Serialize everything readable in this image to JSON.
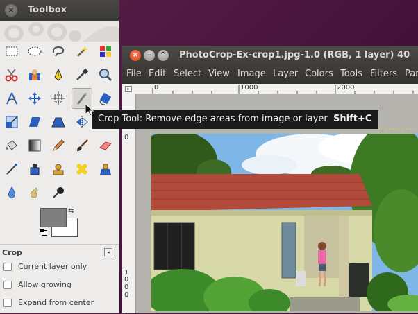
{
  "toolbox": {
    "title": "Toolbox",
    "close_glyph": "×",
    "tool_options": {
      "title": "Crop",
      "menu_glyph": "◂",
      "options": [
        {
          "label": "Current layer only",
          "checked": false
        },
        {
          "label": "Allow growing",
          "checked": false
        },
        {
          "label": "Expand from center",
          "checked": false
        }
      ]
    },
    "colors": {
      "foreground": "#7f7f7f",
      "background": "#ffffff"
    },
    "tools": [
      "rect-select-icon",
      "ellipse-select-icon",
      "free-select-icon",
      "fuzzy-select-icon",
      "color-select-icon",
      "scissors-icon",
      "foreground-select-icon",
      "paths-icon",
      "color-picker-icon",
      "zoom-icon",
      "measure-icon",
      "move-icon",
      "align-icon",
      "crop-icon",
      "rotate-icon",
      "scale-icon",
      "shear-icon",
      "perspective-icon",
      "flip-icon",
      "cage-icon",
      "bucket-fill-icon",
      "blend-icon",
      "pencil-icon",
      "paintbrush-icon",
      "eraser-icon",
      "airbrush-icon",
      "ink-icon",
      "clone-icon",
      "heal-icon",
      "perspective-clone-icon",
      "blur-icon",
      "smudge-icon",
      "dodge-burn-icon"
    ],
    "active_tool": "crop-icon"
  },
  "image_window": {
    "title": "PhotoCrop-Ex-crop1.jpg-1.0 (RGB, 1 layer) 40",
    "menu": [
      "File",
      "Edit",
      "Select",
      "View",
      "Image",
      "Layer",
      "Colors",
      "Tools",
      "Filters",
      "Par"
    ],
    "ruler_top": [
      "0",
      "1000",
      "2000"
    ],
    "ruler_left_a": "0",
    "ruler_left_b": [
      "1",
      "0",
      "0",
      "0"
    ],
    "ruler_corner_glyph": "▸"
  },
  "tooltip": {
    "text": "Crop Tool: Remove edge areas from image or layer",
    "shortcut": "Shift+C"
  },
  "theme": {
    "desktop": "#4a1640",
    "titlebar": "#3c3b37",
    "tooltip": "#1a1a1a"
  }
}
